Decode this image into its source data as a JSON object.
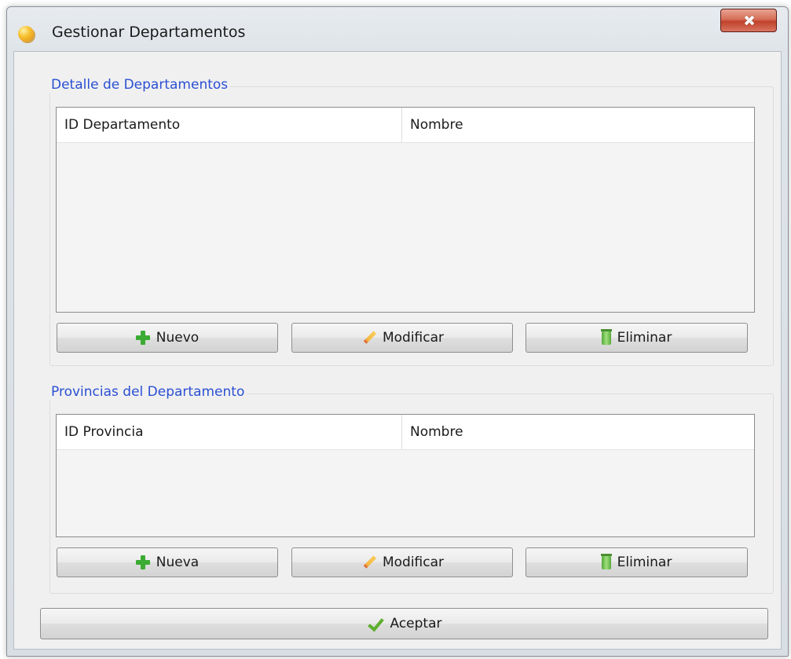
{
  "window": {
    "title": "Gestionar Departamentos"
  },
  "departamentos": {
    "group_title": "Detalle de Departamentos",
    "columns": [
      "ID Departamento",
      "Nombre"
    ],
    "rows": [],
    "buttons": {
      "new": "Nuevo",
      "edit": "Modificar",
      "delete": "Eliminar"
    }
  },
  "provincias": {
    "group_title": "Provincias del Departamento",
    "columns": [
      "ID Provincia",
      "Nombre"
    ],
    "rows": [],
    "buttons": {
      "new": "Nueva",
      "edit": "Modificar",
      "delete": "Eliminar"
    }
  },
  "footer": {
    "accept": "Aceptar"
  },
  "icons": {
    "app": "app-icon",
    "close": "close-icon",
    "add": "plus-icon",
    "edit": "pencil-icon",
    "delete": "trash-icon",
    "accept": "check-icon"
  },
  "colors": {
    "group_title": "#2a4fd3",
    "close_button": "#c0412b",
    "add_icon": "#3cab34",
    "accept_icon": "#5eae2e"
  }
}
